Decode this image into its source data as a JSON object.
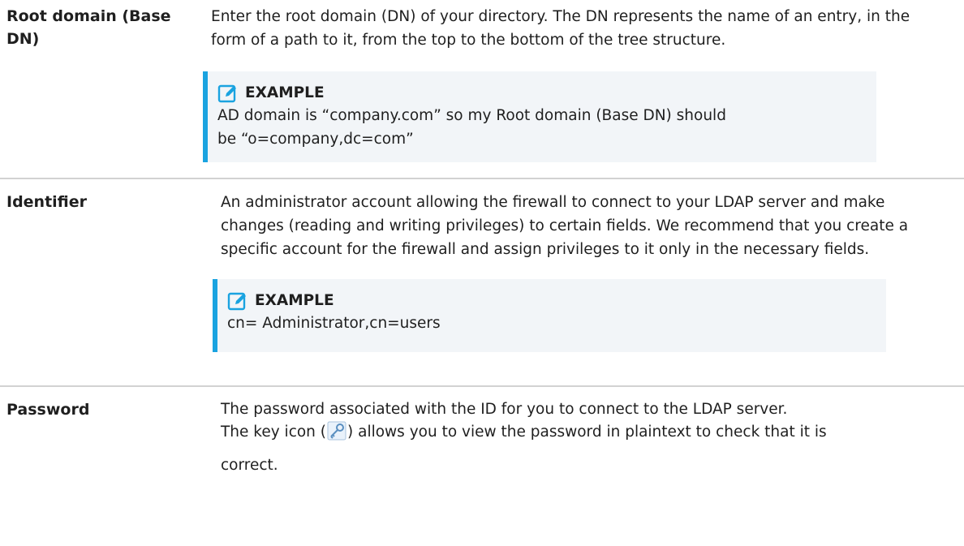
{
  "rows": [
    {
      "term": "Root domain (Base DN)",
      "description": "Enter the root domain (DN) of your directory. The DN represents the name of an entry, in the form of a path to it, from the top to the bottom of the tree structure.",
      "example": {
        "heading": "EXAMPLE",
        "text": "AD domain is “company.com” so my Root domain (Base DN) should be “o=company,dc=com”"
      }
    },
    {
      "term": "Identifier",
      "description": "An administrator account allowing the firewall to connect to your LDAP server and make changes (reading and writing privileges) to certain fields. We recommend that you create a specific account for the firewall and assign privileges to it only in the necessary fields.",
      "example": {
        "heading": "EXAMPLE",
        "text": "cn= Administrator,cn=users"
      }
    },
    {
      "term": "Password",
      "description_line1": "The password associated with the ID for you to connect to the LDAP server.",
      "description_line2_before": "The key icon (",
      "description_line2_after": ") allows you to view the password in plaintext to check that it is",
      "description_line3": "correct."
    }
  ],
  "colors": {
    "accent": "#1aa3e0",
    "callout_bg": "#f2f5f8",
    "divider": "#d2d2d2",
    "text": "#1f1f1f"
  },
  "icons": {
    "example_icon": "edit-icon",
    "inline_icon": "key-icon"
  }
}
